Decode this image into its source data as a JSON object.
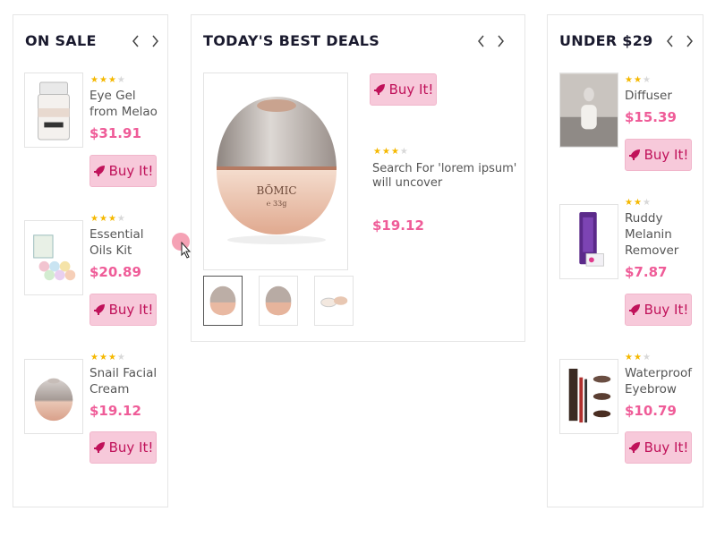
{
  "on_sale": {
    "title": "ON SALE",
    "products": [
      {
        "name": "Eye Gel from Melao",
        "price": "$31.91",
        "rating": 3,
        "buy_label": "Buy It!"
      },
      {
        "name": "Essential Oils Kit",
        "price": "$20.89",
        "rating": 3,
        "buy_label": "Buy It!"
      },
      {
        "name": "Snail Facial Cream",
        "price": "$19.12",
        "rating": 3,
        "buy_label": "Buy It!"
      }
    ]
  },
  "best_deals": {
    "title": "TODAY'S BEST DEALS",
    "buy_label": "Buy It!",
    "description": "Search For 'lorem ipsum' will uncover",
    "price": "$19.12",
    "rating": 3,
    "main_image_icon": "cosmetic-jar-icon",
    "jar_brand": "BŌMIC",
    "jar_weight": "℮ 33g",
    "gallery_count": 3
  },
  "under_29": {
    "title": "UNDER $29",
    "products": [
      {
        "name": "Diffuser",
        "price": "$15.39",
        "rating": 2,
        "buy_label": "Buy It!"
      },
      {
        "name": "Ruddy Melanin Remover",
        "price": "$7.87",
        "rating": 2,
        "buy_label": "Buy It!"
      },
      {
        "name": "Waterproof Eyebrow",
        "price": "$10.79",
        "rating": 2,
        "buy_label": "Buy It!"
      }
    ]
  },
  "icons": {
    "prev": "chevron-left-icon",
    "next": "chevron-right-icon",
    "buy": "rocket-icon",
    "star": "star-icon"
  },
  "colors": {
    "accent_price": "#ef5c98",
    "button_bg": "#f7c9da",
    "button_text": "#c0125a",
    "star": "#f5b800",
    "title": "#1a1a2e"
  }
}
